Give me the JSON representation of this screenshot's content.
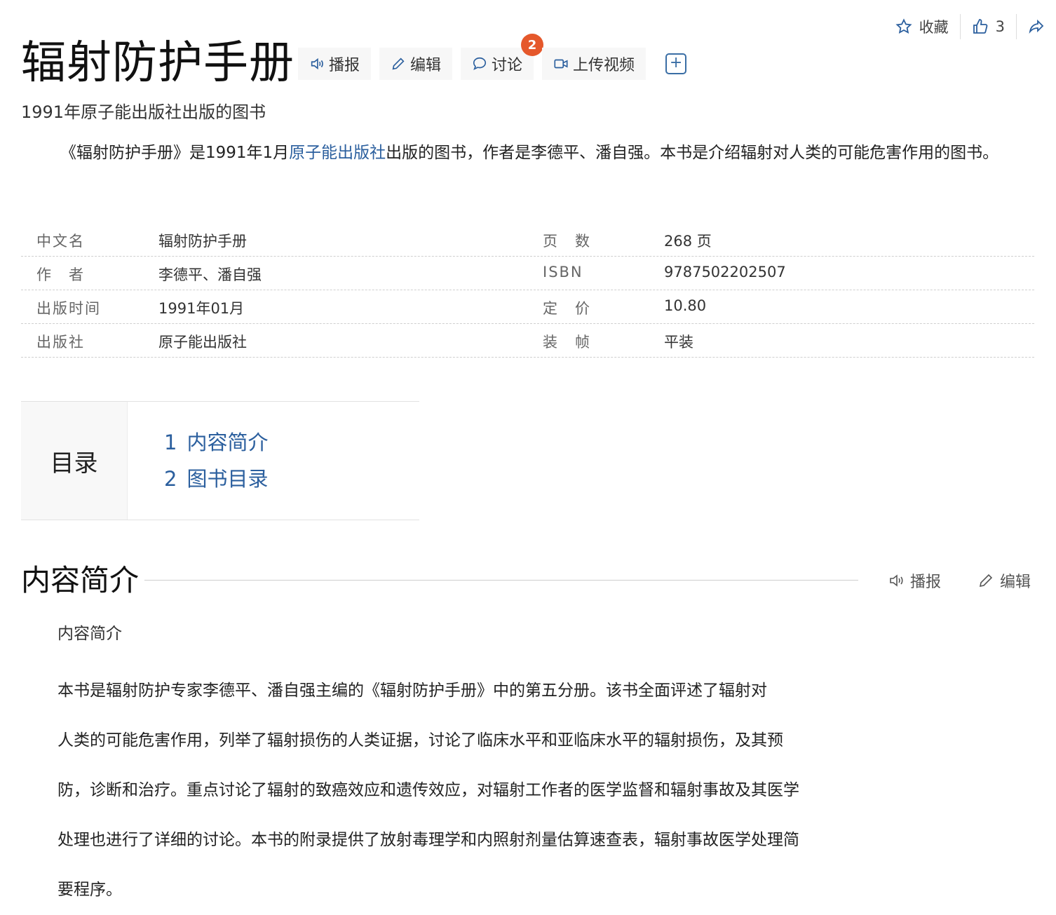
{
  "topbar": {
    "favorite_label": "收藏",
    "like_count": "3"
  },
  "header": {
    "title": "辐射防护手册",
    "tools": {
      "broadcast": "播报",
      "edit": "编辑",
      "discuss": "讨论",
      "discuss_badge": "2",
      "upload_video": "上传视频"
    }
  },
  "subtitle": "1991年原子能出版社出版的图书",
  "summary": {
    "part1": "《辐射防护手册》是1991年1月",
    "link": "原子能出版社",
    "part2": "出版的图书，作者是李德平、潘自强。本书是介绍辐射对人类的可能危害作用的图书。"
  },
  "info": [
    {
      "k1": "中文名",
      "v1": "辐射防护手册",
      "k2": "页　数",
      "v2": "268 页"
    },
    {
      "k1": "作　者",
      "v1": "李德平、潘自强",
      "k2": "ISBN",
      "v2": "9787502202507"
    },
    {
      "k1": "出版时间",
      "v1": "1991年01月",
      "k2": "定　价",
      "v2": "10.80"
    },
    {
      "k1": "出版社",
      "v1": "原子能出版社",
      "k2": "装　帧",
      "v2": "平装"
    }
  ],
  "catalog": {
    "label": "目录",
    "items": [
      {
        "num": "1",
        "text": "内容简介"
      },
      {
        "num": "2",
        "text": "图书目录"
      }
    ]
  },
  "section": {
    "title": "内容简介",
    "broadcast": "播报",
    "edit": "编辑",
    "subhead": "内容简介",
    "lines": [
      "本书是辐射防护专家李德平、潘自强主编的《辐射防护手册》中的第五分册。该书全面评述了辐射对",
      "人类的可能危害作用，列举了辐射损伤的人类证据，讨论了临床水平和亚临床水平的辐射损伤，及其预",
      "防，诊断和治疗。重点讨论了辐射的致癌效应和遗传效应，对辐射工作者的医学监督和辐射事故及其医学",
      "处理也进行了详细的讨论。本书的附录提供了放射毒理学和内照射剂量估算速查表，辐射事故医学处理简",
      "要程序。"
    ]
  }
}
